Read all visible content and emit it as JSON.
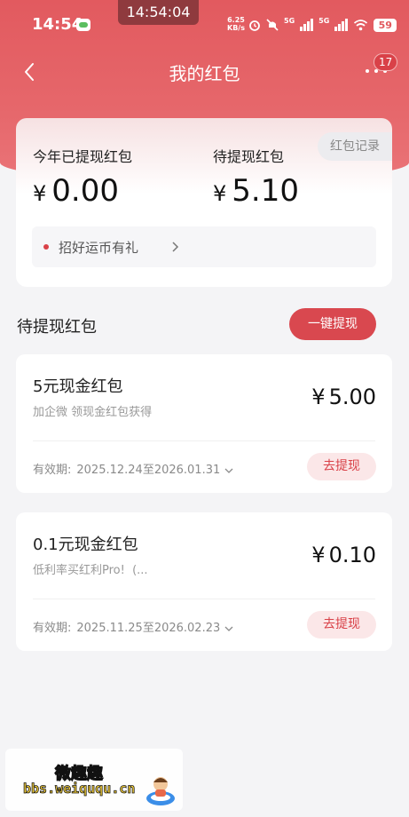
{
  "status_bar": {
    "time": "14:54",
    "center_time": "14:54:04",
    "net_speed_value": "6.25",
    "net_speed_unit": "KB/s",
    "signal_label_1": "5G",
    "signal_label_2": "5G",
    "battery": "59",
    "icons": [
      "wechat-icon",
      "alarm-icon",
      "mute-icon",
      "signal-icon",
      "wifi-icon",
      "battery-icon"
    ]
  },
  "nav": {
    "title": "我的红包",
    "back_icon": "chevron-left-icon",
    "more_icon": "more-dots-icon",
    "badge": "17"
  },
  "summary": {
    "records_button": "红包记录",
    "withdrawn_label": "今年已提现红包",
    "withdrawn_currency": "¥",
    "withdrawn_amount": "0.00",
    "pending_label": "待提现红包",
    "pending_currency": "¥",
    "pending_amount": "5.10",
    "promo_text": "招好运币有礼"
  },
  "section": {
    "title": "待提现红包",
    "withdraw_all_button": "一键提现"
  },
  "coupons": [
    {
      "title": "5元现金红包",
      "subtitle": "加企微 领现金红包获得",
      "currency": "¥",
      "amount": "5.00",
      "validity_label": "有效期:",
      "validity_date": "2025.12.24至2026.01.31",
      "button": "去提现"
    },
    {
      "title": "0.1元现金红包",
      "subtitle": "低利率买红利Pro!  (...",
      "currency": "¥",
      "amount": "0.10",
      "validity_label": "有效期:",
      "validity_date": "2025.11.25至2026.02.23",
      "button": "去提现"
    }
  ],
  "watermark": {
    "title": "微趣趣",
    "url": "bbs.weiququ.cn"
  },
  "colors": {
    "brand_red": "#e25a5f",
    "button_red": "#d9484f",
    "soft_pink": "#fbe7e8",
    "page_bg": "#f4f4f6"
  }
}
